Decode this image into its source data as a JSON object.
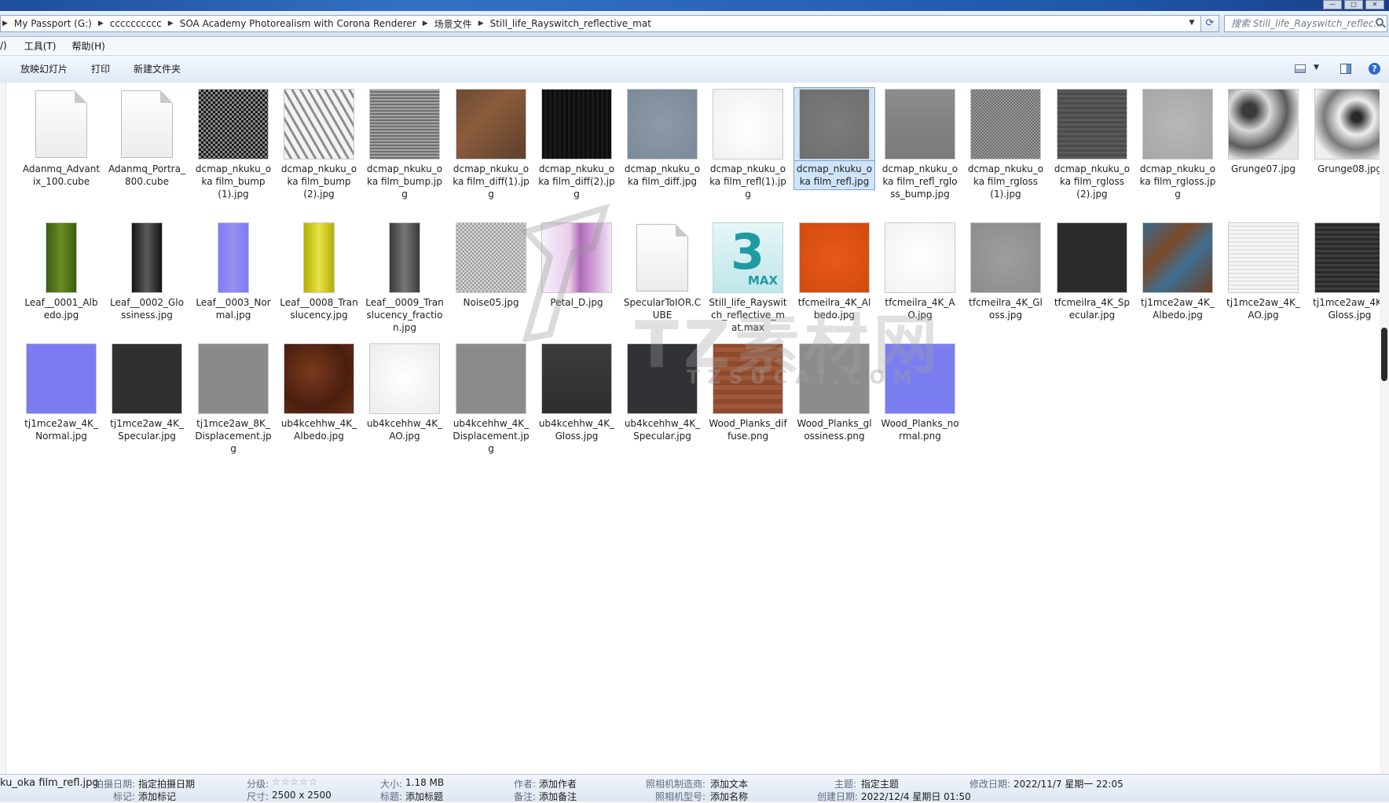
{
  "breadcrumb": [
    "My Passport (G:)",
    "cccccccccc",
    "SOA Academy Photorealism with Corona Renderer",
    "场景文件",
    "Still_life_Rayswitch_reflective_mat"
  ],
  "search": {
    "placeholder": "搜索 Still_life_Rayswitch_reflec..."
  },
  "menu": [
    "/)",
    "工具(T)",
    "帮助(H)"
  ],
  "commands": {
    "slideshow": "放映幻灯片",
    "print": "打印",
    "new_folder": "新建文件夹"
  },
  "files": [
    {
      "name": "Adanmq_Advantix_100.cube",
      "kind": "doc",
      "fill": "#f2f2f2"
    },
    {
      "name": "Adanmq_Portra_800.cube",
      "kind": "doc",
      "fill": "#f2f2f2"
    },
    {
      "name": "dcmap_nkuku_oka film_bump(1).jpg",
      "kind": "img",
      "fill": "repeating-conic-gradient(#1a1a1a 0 25%,#8a8a8a 0 50%) 0 0/6px 6px"
    },
    {
      "name": "dcmap_nkuku_oka film_bump(2).jpg",
      "kind": "img",
      "fill": "repeating-linear-gradient(60deg,#f3f3f3 0 6px,#8e8e8e 6px 9px),#ccc"
    },
    {
      "name": "dcmap_nkuku_oka film_bump.jpg",
      "kind": "img",
      "fill": "repeating-linear-gradient(0deg,#6f6f6f 0 2px,#a3a3a3 2px 4px)"
    },
    {
      "name": "dcmap_nkuku_oka film_diff(1).jpg",
      "kind": "img",
      "fill": "linear-gradient(135deg,#6d4b33,#8b5c3c 40%,#5b3f2c)"
    },
    {
      "name": "dcmap_nkuku_oka film_diff(2).jpg",
      "kind": "img",
      "fill": "repeating-linear-gradient(90deg,#0d0d0d 0 3px,#1a1a1a 3px 6px)"
    },
    {
      "name": "dcmap_nkuku_oka film_diff.jpg",
      "kind": "img",
      "fill": "radial-gradient(circle at 50% 50%,#8d9aa8,#7a8999)"
    },
    {
      "name": "dcmap_nkuku_oka film_refl(1).jpg",
      "kind": "img",
      "fill": "radial-gradient(circle at 50% 55%,#ffffff,#f0f0f0)"
    },
    {
      "name": "dcmap_nkuku_oka film_refl.jpg",
      "kind": "img",
      "fill": "radial-gradient(circle at 50% 50%,#7c7c7c,#6e6e6e)",
      "selected": true
    },
    {
      "name": "dcmap_nkuku_oka film_refl_rgloss_bump.jpg",
      "kind": "img",
      "fill": "linear-gradient(#8c8c8c,#7a7a7a)"
    },
    {
      "name": "dcmap_nkuku_oka film_rgloss(1).jpg",
      "kind": "img",
      "fill": "repeating-conic-gradient(#6d6d6d 0 25%,#9a9a9a 0 50%) 0 0/4px 4px"
    },
    {
      "name": "dcmap_nkuku_oka film_rgloss(2).jpg",
      "kind": "img",
      "fill": "repeating-linear-gradient(0deg,#5a5a5a 0 3px,#4b4b4b 3px 6px)"
    },
    {
      "name": "dcmap_nkuku_oka film_rgloss.jpg",
      "kind": "img",
      "fill": "radial-gradient(circle at 50% 50%,#b8b8b8,#a6a6a6)"
    },
    {
      "name": "Grunge07.jpg",
      "kind": "img",
      "fill": "radial-gradient(circle at 30% 30%,#3a3a3a 10%,#d9d9d9 30%,#5b5b5b 55%,#e6e6e6 75%)"
    },
    {
      "name": "Grunge08.jpg",
      "kind": "img",
      "fill": "radial-gradient(circle at 60% 40%,#2a2a2a 8%,#eeeeee 30%,#7a7a7a 55%,#f0f0f0 80%)"
    },
    {
      "name": "Leaf__0001_Albedo.jpg",
      "kind": "tall",
      "fill": "linear-gradient(90deg,#3c5d12,#6b8c22 50%,#3c5d12)"
    },
    {
      "name": "Leaf__0002_Glossiness.jpg",
      "kind": "tall",
      "fill": "linear-gradient(90deg,#141414,#5c5c5c 50%,#141414)"
    },
    {
      "name": "Leaf__0003_Normal.jpg",
      "kind": "tall",
      "fill": "linear-gradient(90deg,#7b7cf6,#9c8ef0 50%,#7b7cf6)"
    },
    {
      "name": "Leaf__0008_Translucency.jpg",
      "kind": "tall",
      "fill": "linear-gradient(90deg,#b5b000,#e6e24a 50%,#b5b000)"
    },
    {
      "name": "Leaf__0009_Translucency_fraction.jpg",
      "kind": "tall",
      "fill": "linear-gradient(90deg,#3a3a3a,#777 50%,#3a3a3a)"
    },
    {
      "name": "Noise05.jpg",
      "kind": "img",
      "fill": "repeating-conic-gradient(#9a9a9a 0 25%,#dcdcdc 0 50%) 0 0/5px 5px"
    },
    {
      "name": "Petal_D.jpg",
      "kind": "img",
      "fill": "linear-gradient(90deg,#f7f0fb,#e9cde9 40%,#b06ab8 55%,#f3e6f6)"
    },
    {
      "name": "SpecularToIOR.CUBE",
      "kind": "doc",
      "fill": "#f2f2f2"
    },
    {
      "name": "Still_life_Rayswitch_reflective_mat.max",
      "kind": "max",
      "fill": "#bfe6ea"
    },
    {
      "name": "tfcmeilra_4K_Albedo.jpg",
      "kind": "img",
      "fill": "radial-gradient(circle at 50% 50%,#e8581a,#d24a0e)"
    },
    {
      "name": "tfcmeilra_4K_AO.jpg",
      "kind": "img",
      "fill": "radial-gradient(circle at 50% 50%,#ffffff,#f2f2f2)"
    },
    {
      "name": "tfcmeilra_4K_Gloss.jpg",
      "kind": "img",
      "fill": "radial-gradient(circle at 50% 50%,#9e9e9e,#8c8c8c)"
    },
    {
      "name": "tfcmeilra_4K_Specular.jpg",
      "kind": "img",
      "fill": "#2b2b2b"
    },
    {
      "name": "tj1mce2aw_4K_Albedo.jpg",
      "kind": "img",
      "fill": "linear-gradient(135deg,#3b6a8c,#7a4a2a 35%,#3f6e90 60%,#6b3f22)"
    },
    {
      "name": "tj1mce2aw_4K_AO.jpg",
      "kind": "img",
      "fill": "repeating-linear-gradient(0deg,#f6f6f6 0 3px,#e3e3e3 3px 5px)"
    },
    {
      "name": "tj1mce2aw_4K_Gloss.jpg",
      "kind": "img",
      "fill": "repeating-linear-gradient(0deg,#2a2a2a 0 3px,#3d3d3d 3px 6px)"
    },
    {
      "name": "tj1mce2aw_4K_Normal.jpg",
      "kind": "img",
      "fill": "#7c7cf2"
    },
    {
      "name": "tj1mce2aw_4K_Specular.jpg",
      "kind": "img",
      "fill": "#303030"
    },
    {
      "name": "tj1mce2aw_8K_Displacement.jpg",
      "kind": "img",
      "fill": "#8a8a8a"
    },
    {
      "name": "ub4kcehhw_4K_Albedo.jpg",
      "kind": "img",
      "fill": "radial-gradient(circle at 40% 40%,#7a3a1c,#4a1e10 60%,#6b2f16)"
    },
    {
      "name": "ub4kcehhw_4K_AO.jpg",
      "kind": "img",
      "fill": "radial-gradient(circle at 50% 50%,#ffffff,#ececec)"
    },
    {
      "name": "ub4kcehhw_4K_Displacement.jpg",
      "kind": "img",
      "fill": "#8b8b8b"
    },
    {
      "name": "ub4kcehhw_4K_Gloss.jpg",
      "kind": "img",
      "fill": "linear-gradient(#3c3c3c,#2e2e2e)"
    },
    {
      "name": "ub4kcehhw_4K_Specular.jpg",
      "kind": "img",
      "fill": "#303236"
    },
    {
      "name": "Wood_Planks_diffuse.png",
      "kind": "img",
      "fill": "repeating-linear-gradient(0deg,#8e4a2c 0 6px,#a0583a 6px 12px)"
    },
    {
      "name": "Wood_Planks_glossiness.png",
      "kind": "img",
      "fill": "#8c8c8c"
    },
    {
      "name": "Wood_Planks_normal.png",
      "kind": "img",
      "fill": "#7a7ef0"
    }
  ],
  "watermark": {
    "text": "TZ素材网",
    "sub": "TZSUCAI.COM"
  },
  "details": {
    "filename": "ku_oka film_refl.jpg",
    "date_taken_k": "拍摄日期:",
    "date_taken_v": "指定拍摄日期",
    "tags_k": "标记:",
    "tags_v": "添加标记",
    "rating_k": "分级:",
    "rating_v": "☆☆☆☆☆",
    "dims_k": "尺寸:",
    "dims_v": "2500 x 2500",
    "size_k": "大小:",
    "size_v": "1.18 MB",
    "title_k": "标题:",
    "title_v": "添加标题",
    "author_k": "作者:",
    "author_v": "添加作者",
    "comment_k": "备注:",
    "comment_v": "添加备注",
    "maker_k": "照相机制造商:",
    "maker_v": "添加文本",
    "model_k": "照相机型号:",
    "model_v": "添加名称",
    "subject_k": "主题:",
    "subject_v": "指定主题",
    "created_k": "创建日期:",
    "created_v": "2022/12/4 星期日 01:50",
    "modified_k": "修改日期:",
    "modified_v": "2022/11/7 星期一 22:05"
  }
}
